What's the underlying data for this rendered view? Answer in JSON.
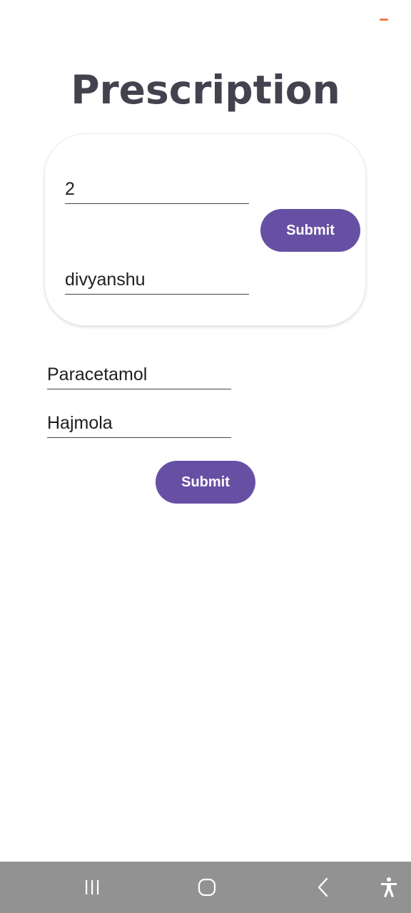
{
  "status_bar": {
    "indicator_color": "#f07a4a"
  },
  "page": {
    "title": "Prescription"
  },
  "card": {
    "field_one_value": "2",
    "field_two_value": "divyanshu",
    "submit_label": "Submit"
  },
  "medicines": {
    "items": [
      "Paracetamol",
      "Hajmola"
    ],
    "submit_label": "Submit"
  },
  "theme": {
    "accent": "#6750a4",
    "title_color": "#45424f",
    "nav_bar_color": "#929292"
  },
  "nav_bar": {
    "icons": [
      "recents-icon",
      "home-icon",
      "back-icon",
      "accessibility-icon"
    ]
  }
}
